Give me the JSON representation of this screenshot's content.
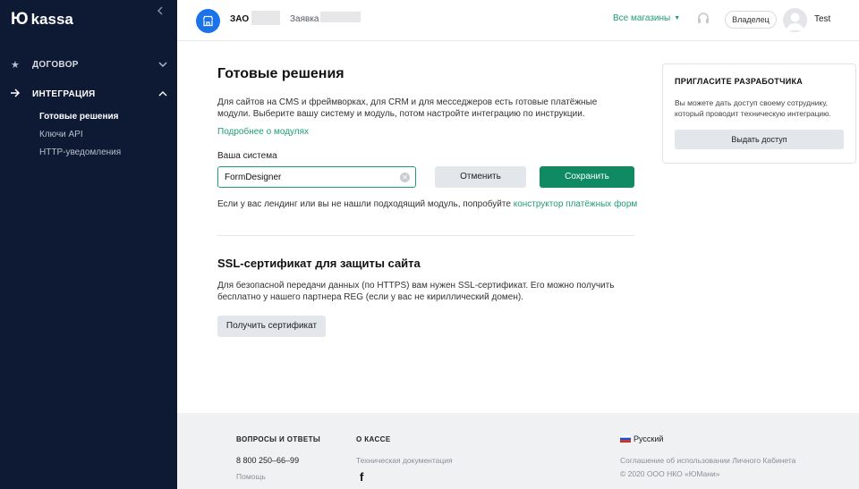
{
  "brand": {
    "logo_mark": "Ю",
    "logo_text": "kassa"
  },
  "sidebar": {
    "sections": [
      {
        "label": "ДОГОВОР",
        "icon": "star-icon",
        "expanded": false
      },
      {
        "label": "ИНТЕГРАЦИЯ",
        "icon": "arrow-right-icon",
        "expanded": true
      }
    ],
    "subitems": [
      {
        "label": "Готовые решения",
        "active": true
      },
      {
        "label": "Ключи API",
        "active": false
      },
      {
        "label": "HTTP-уведомления",
        "active": false
      }
    ]
  },
  "header": {
    "company": "ЗАО",
    "request": "Заявка",
    "all_stores": "Все магазины",
    "role": "Владелец",
    "user_name": "Test"
  },
  "main": {
    "title": "Готовые решения",
    "intro": "Для сайтов на CMS и фреймворках, для CRM и для месседжеров есть готовые платёжные модули. Выберите вашу систему и модуль, потом настройте интеграцию по инструкции.",
    "more_link": "Подробнее о модулях",
    "system_label": "Ваша система",
    "system_value": "FormDesigner",
    "cancel_label": "Отменить",
    "save_label": "Сохранить",
    "landing_text": "Если у вас лендинг или вы не нашли подходящий модуль, попробуйте",
    "landing_link": "конструктор платёжных форм",
    "ssl_title": "SSL-сертификат для защиты сайта",
    "ssl_text": "Для безопасной передачи данных (по HTTPS) вам нужен SSL-сертификат. Его можно получить бесплатно у нашего партнера REG (если у вас не кириллический домен).",
    "cert_button": "Получить сертификат"
  },
  "invite": {
    "title": "ПРИГЛАСИТЕ РАЗРАБОТЧИКА",
    "text": "Вы можете дать доступ своему сотруднику, который проводит техническую интеграцию.",
    "button": "Выдать доступ"
  },
  "footer": {
    "faq_title": "ВОПРОСЫ И ОТВЕТЫ",
    "phone": "8 800 250–66–99",
    "help": "Помощь",
    "about_title": "О КАССЕ",
    "docs": "Техническая документация",
    "facebook": "f",
    "language": "Русский",
    "terms": "Соглашение об использовании Личного Кабинета",
    "copyright": "© 2020  ООО НКО «ЮМани»"
  },
  "colors": {
    "sidebar_bg": "#0e1a33",
    "accent_green": "#0f8a62",
    "link_green": "#1f9e72",
    "avatar_blue": "#1a73e8"
  }
}
